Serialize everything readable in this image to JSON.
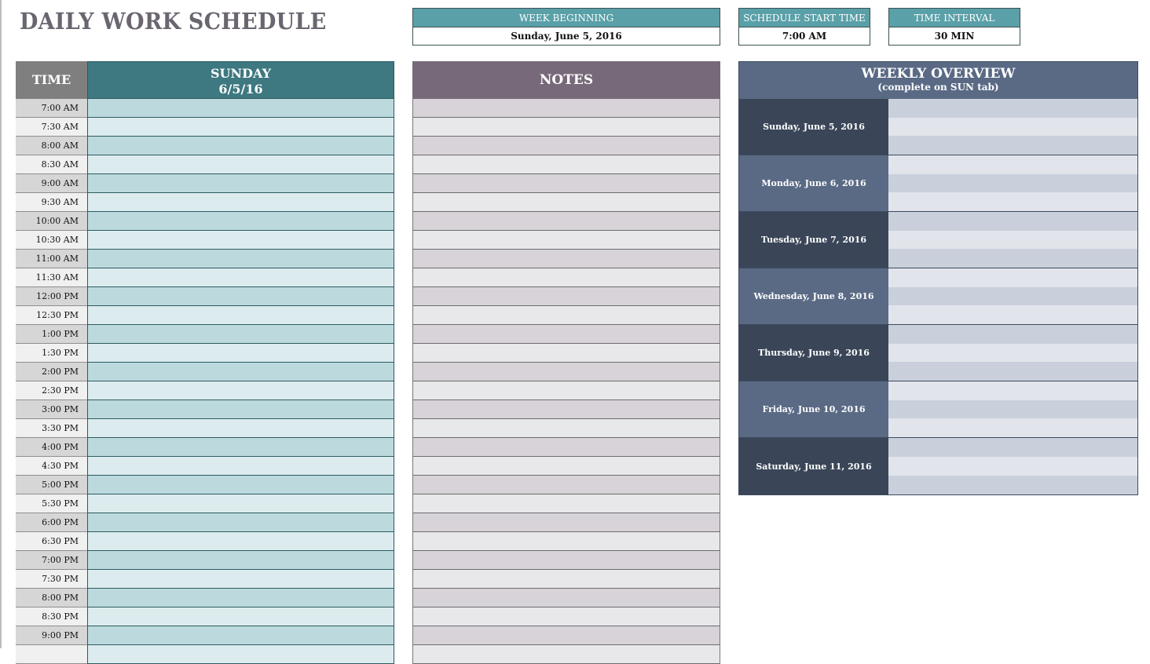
{
  "title": "DAILY WORK SCHEDULE",
  "info": {
    "week_beginning": {
      "label": "WEEK BEGINNING",
      "value": "Sunday, June 5, 2016"
    },
    "start_time": {
      "label": "SCHEDULE START TIME",
      "value": "7:00 AM"
    },
    "interval": {
      "label": "TIME INTERVAL",
      "value": "30 MIN"
    }
  },
  "schedule": {
    "time_header": "TIME",
    "day_header": "SUNDAY",
    "day_date": "6/5/16",
    "notes_header": "NOTES",
    "times": [
      "7:00 AM",
      "7:30 AM",
      "8:00 AM",
      "8:30 AM",
      "9:00 AM",
      "9:30 AM",
      "10:00 AM",
      "10:30 AM",
      "11:00 AM",
      "11:30 AM",
      "12:00 PM",
      "12:30 PM",
      "1:00 PM",
      "1:30 PM",
      "2:00 PM",
      "2:30 PM",
      "3:00 PM",
      "3:30 PM",
      "4:00 PM",
      "4:30 PM",
      "5:00 PM",
      "5:30 PM",
      "6:00 PM",
      "6:30 PM",
      "7:00 PM",
      "7:30 PM",
      "8:00 PM",
      "8:30 PM",
      "9:00 PM",
      ""
    ]
  },
  "weekly_overview": {
    "title": "WEEKLY OVERVIEW",
    "subtitle": "(complete on SUN tab)",
    "days": [
      "Sunday, June 5, 2016",
      "Monday, June 6, 2016",
      "Tuesday, June 7, 2016",
      "Wednesday, June 8, 2016",
      "Thursday, June 9, 2016",
      "Friday, June 10, 2016",
      "Saturday, June 11, 2016"
    ]
  },
  "colors": {
    "teal_header": "#3e7880",
    "info_label": "#5aa0a8",
    "notes_header": "#77697a",
    "overview_header": "#5a6a85",
    "overview_dark": "#3a4658"
  }
}
